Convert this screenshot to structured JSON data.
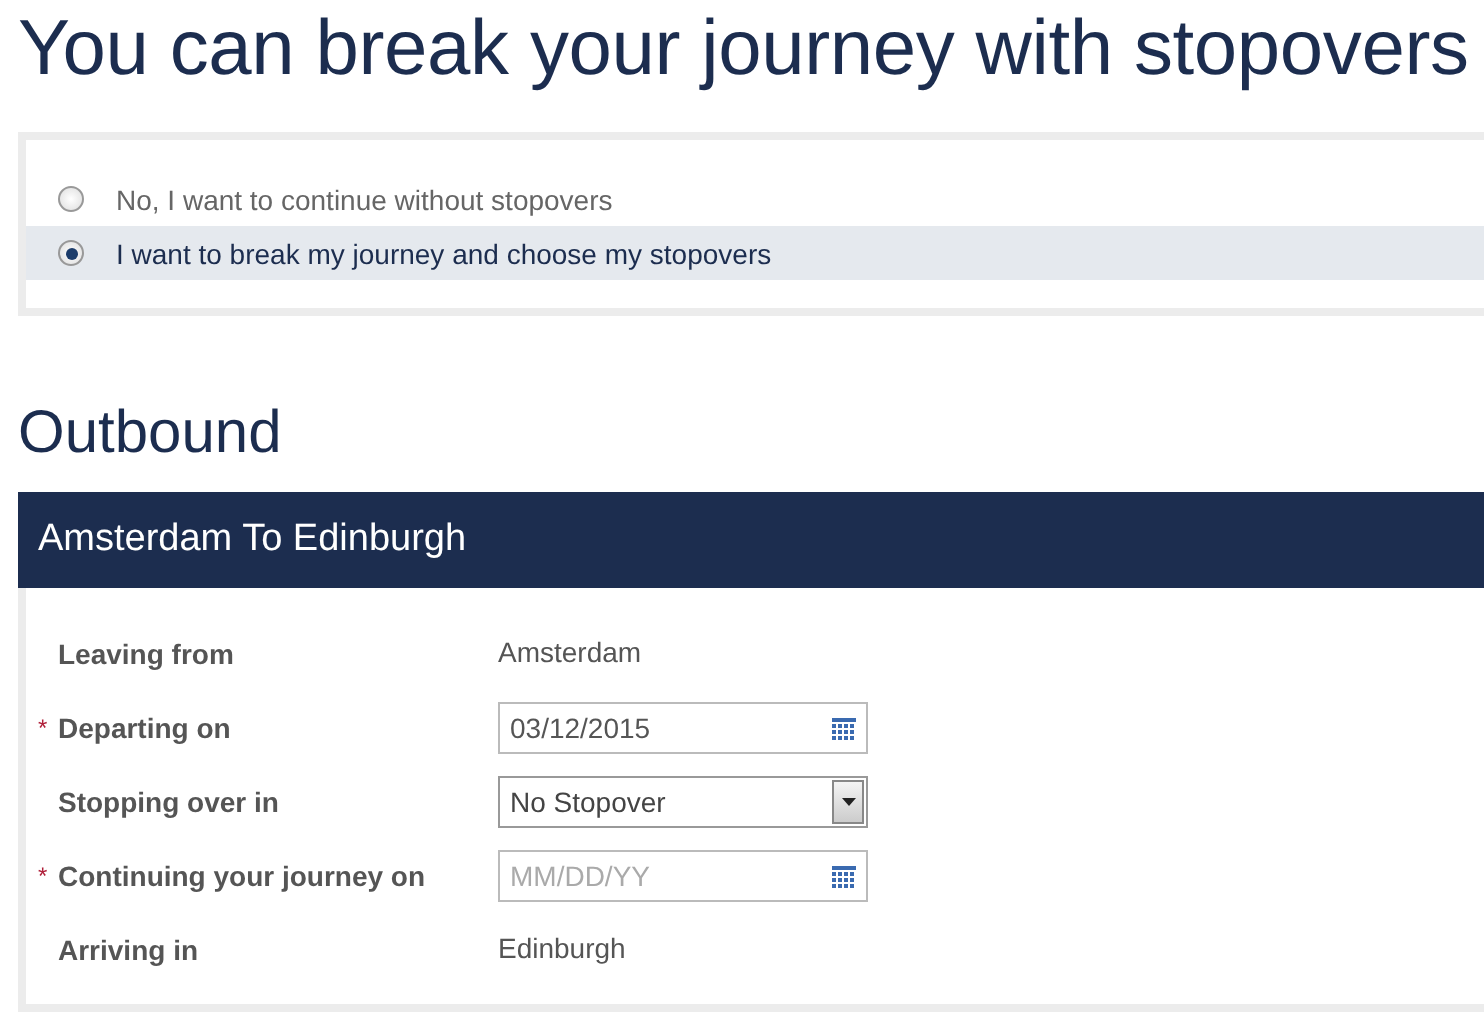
{
  "title": "You can break your journey with stopovers",
  "options": [
    {
      "label": "No, I want to continue without stopovers",
      "selected": false
    },
    {
      "label": "I want to break my journey and choose my stopovers",
      "selected": true
    }
  ],
  "section_title": "Outbound",
  "route": {
    "title": "Amsterdam To Edinburgh",
    "fields": [
      {
        "label": "Leaving from",
        "kind": "text",
        "value": "Amsterdam"
      },
      {
        "marker": "*",
        "label": "Departing on",
        "kind": "date",
        "value": "03/12/2015"
      },
      {
        "label": "Stopping over in",
        "kind": "select",
        "value": "No Stopover"
      },
      {
        "marker": "*",
        "label": "Continuing your journey on",
        "kind": "date",
        "placeholder": "MM/DD/YY"
      },
      {
        "label": "Arriving in",
        "kind": "text",
        "value": "Edinburgh"
      }
    ]
  }
}
